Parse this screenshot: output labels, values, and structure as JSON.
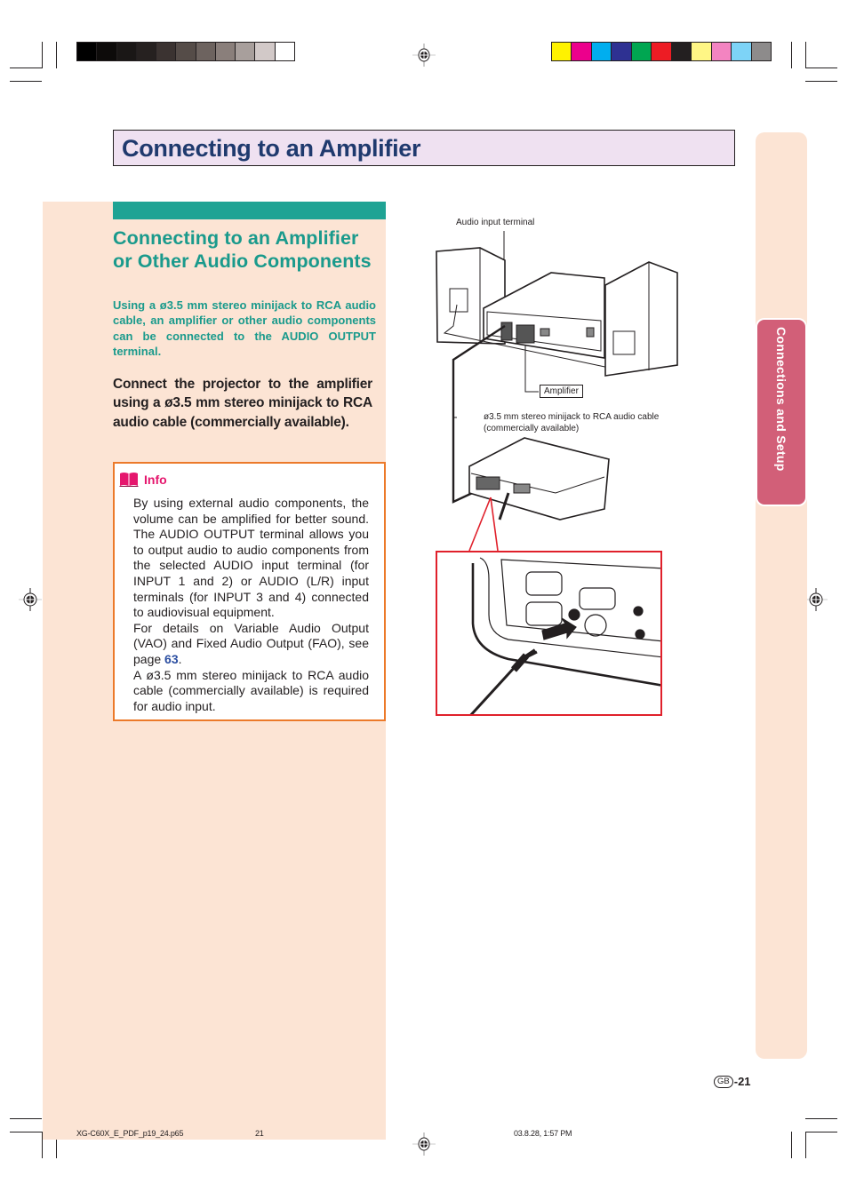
{
  "print_marks": {
    "gray_swatches": [
      "#000000",
      "#0d0b0a",
      "#1a1716",
      "#262120",
      "#3b3331",
      "#554c48",
      "#6d635f",
      "#8a7f7b",
      "#a89f9c",
      "#d2c9c8",
      "#ffffff"
    ],
    "color_swatches": [
      "#fff200",
      "#ec008c",
      "#00aeef",
      "#2e3192",
      "#00a651",
      "#ed1c24",
      "#231f20",
      "#fff685",
      "#f384c1",
      "#7dd3f7",
      "#8d8b8b"
    ]
  },
  "page": {
    "title": "Connecting to an Amplifier",
    "section": {
      "heading": "Connecting to an Amplifier or Other Audio Components",
      "intro": "Using a ø3.5 mm stereo minijack to RCA audio cable, an amplifier or other audio components can be connected to the AUDIO OUTPUT terminal.",
      "instruction": "Connect the projector to the amplifier using a ø3.5 mm stereo minijack to RCA audio cable (commercially available)."
    },
    "info": {
      "icon": "book-icon",
      "label": "Info",
      "para1": "By using external audio components, the volume can be amplified for better sound. The AUDIO OUTPUT terminal allows you to output audio to audio components from the selected AUDIO input terminal (for INPUT 1 and 2) or AUDIO (L/R) input terminals (for INPUT 3 and 4) connected to audiovisual equipment.",
      "para2_before": "For details on Variable Audio Output (VAO) and Fixed Audio Output (FAO), see page ",
      "para2_link": "63",
      "para2_after": ".",
      "para3": "A ø3.5 mm stereo minijack to RCA audio cable (commercially available) is required for audio input."
    },
    "diagram": {
      "callout_audio_input": "Audio input terminal",
      "callout_amplifier": "Amplifier",
      "callout_cable_line1": "ø3.5 mm stereo minijack to RCA audio cable",
      "callout_cable_line2": "(commercially available)"
    },
    "side_tab": {
      "label": "Connections and Setup"
    },
    "page_number": {
      "badge": "GB",
      "number": "-21"
    },
    "footer": {
      "file": "XG-C60X_E_PDF_p19_24.p65",
      "page": "21",
      "timestamp": "03.8.28, 1:57 PM"
    },
    "colors": {
      "title_text": "#1f3a6e",
      "title_bg": "#efe1f1",
      "teal": "#1a9a8c",
      "peach": "#fce4d4",
      "info_border": "#ec7a2a",
      "info_label": "#e5166d",
      "tab_active": "#d25f78",
      "zoom_frame": "#e0202b"
    }
  }
}
